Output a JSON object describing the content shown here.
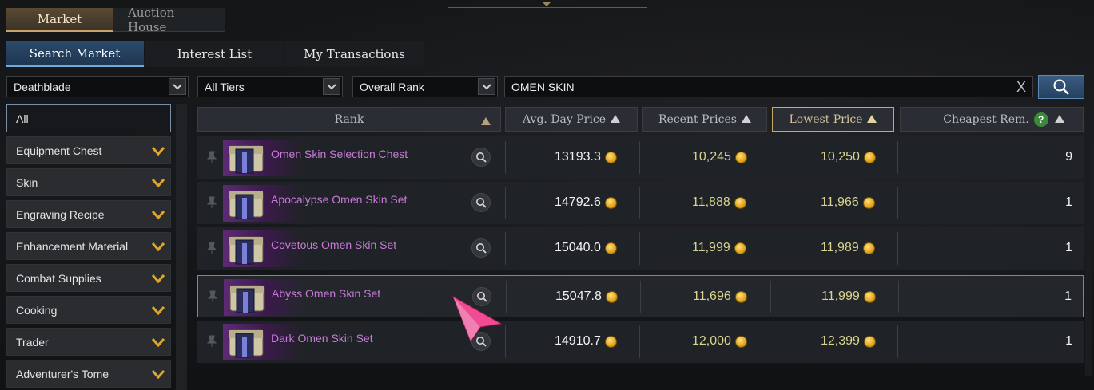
{
  "main_tabs": [
    {
      "label": "Market",
      "active": true
    },
    {
      "label": "Auction House",
      "active": false
    }
  ],
  "sub_tabs": [
    {
      "label": "Search Market",
      "active": true
    },
    {
      "label": "Interest List",
      "active": false
    },
    {
      "label": "My Transactions",
      "active": false
    }
  ],
  "filters": {
    "class": "Deathblade",
    "tier": "All Tiers",
    "sort": "Overall Rank",
    "search_value": "OMEN SKIN",
    "clear_label": "X"
  },
  "categories": [
    {
      "label": "All",
      "active": true
    },
    {
      "label": "Equipment Chest"
    },
    {
      "label": "Skin"
    },
    {
      "label": "Engraving Recipe"
    },
    {
      "label": "Enhancement Material"
    },
    {
      "label": "Combat Supplies"
    },
    {
      "label": "Cooking"
    },
    {
      "label": "Trader"
    },
    {
      "label": "Adventurer's Tome"
    }
  ],
  "columns": {
    "rank": "Rank",
    "avg_day_price": "Avg. Day Price",
    "recent_prices": "Recent Prices",
    "lowest_price": "Lowest Price",
    "cheapest_rem": "Cheapest Rem.",
    "help": "?"
  },
  "rows": [
    {
      "name": "Omen Skin Selection Chest",
      "avg": "13193.3",
      "recent": "10,245",
      "lowest": "10,250",
      "rem": "9"
    },
    {
      "name": "Apocalypse Omen Skin Set",
      "avg": "14792.6",
      "recent": "11,888",
      "lowest": "11,966",
      "rem": "1"
    },
    {
      "name": "Covetous Omen Skin Set",
      "avg": "15040.0",
      "recent": "11,999",
      "lowest": "11,989",
      "rem": "1"
    },
    {
      "name": "Abyss Omen Skin Set",
      "avg": "15047.8",
      "recent": "11,696",
      "lowest": "11,999",
      "rem": "1"
    },
    {
      "name": "Dark Omen Skin Set",
      "avg": "14910.7",
      "recent": "12,000",
      "lowest": "12,399",
      "rem": "1"
    }
  ],
  "colors": {
    "accent_gold": "#c8a56a",
    "accent_blue": "#6fa9dd",
    "item_name": "#c97ad8",
    "price_gold": "#d9d48e"
  },
  "icons": {
    "favorite": "pin-icon",
    "inspect": "magnifier-icon",
    "currency": "gold-coin-icon"
  }
}
